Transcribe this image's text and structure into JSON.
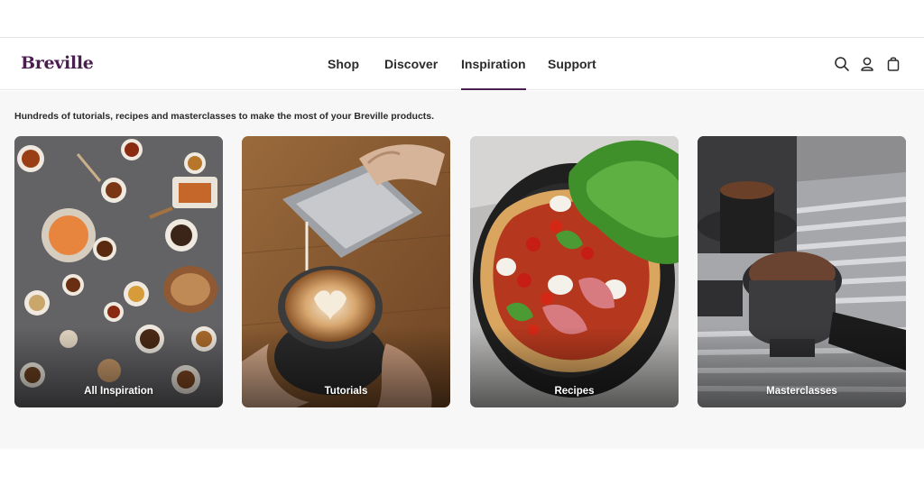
{
  "brand": {
    "logo_text": "Breville",
    "accent_color": "#4a1f4f"
  },
  "nav": {
    "items": [
      {
        "label": "Shop",
        "active": false
      },
      {
        "label": "Discover",
        "active": false
      },
      {
        "label": "Inspiration",
        "active": true
      },
      {
        "label": "Support",
        "active": false
      }
    ]
  },
  "header_icons": [
    "search-icon",
    "account-icon",
    "bag-icon"
  ],
  "main": {
    "intro": "Hundreds of tutorials, recipes and masterclasses to make the most of your Breville products.",
    "cards": [
      {
        "label": "All Inspiration",
        "image": "tea-spread-photo"
      },
      {
        "label": "Tutorials",
        "image": "latte-art-photo"
      },
      {
        "label": "Recipes",
        "image": "pizza-photo"
      },
      {
        "label": "Masterclasses",
        "image": "espresso-machine-photo"
      }
    ]
  }
}
